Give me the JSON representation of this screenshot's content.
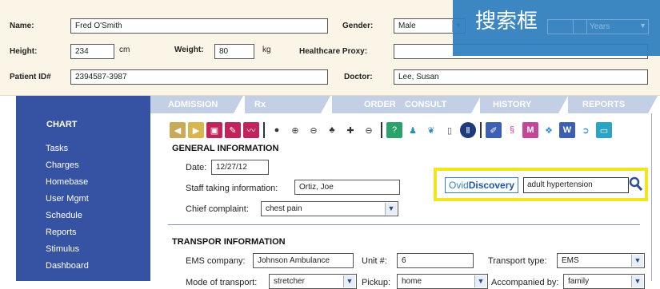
{
  "overlay": {
    "title": "搜索框",
    "ghost_value": "Years"
  },
  "form": {
    "name_label": "Name:",
    "name_value": "Fred O'Smith",
    "gender_label": "Gender:",
    "gender_value": "Male",
    "height_label": "Height:",
    "height_value": "234",
    "height_unit": "cm",
    "weight_label": "Weight:",
    "weight_value": "80",
    "weight_unit": "kg",
    "proxy_label": "Healthcare Proxy:",
    "proxy_value": "",
    "patient_id_label": "Patient ID#",
    "patient_id_value": "2394587-3987",
    "doctor_label": "Doctor:",
    "doctor_value": "Lee, Susan"
  },
  "tabs": [
    {
      "label": "ADMISSION"
    },
    {
      "label": "Rx"
    },
    {
      "label": "ORDERS"
    },
    {
      "label": "CONSULT"
    },
    {
      "label": "HISTORY"
    },
    {
      "label": "REPORTS"
    }
  ],
  "sidebar": {
    "heading": "CHART",
    "items": [
      "Tasks",
      "Charges",
      "Homebase",
      "User Mgmt",
      "Schedule",
      "Reports",
      "Stimulus",
      "Dashboard"
    ]
  },
  "toolbar_icons": [
    "arrow-left-icon",
    "arrow-right-icon",
    "device-icon",
    "note-icon",
    "chart-icon",
    "globe-icon",
    "zoom-icon",
    "zoom-out-icon",
    "people-icon",
    "pill-icon",
    "bed-icon",
    "help-icon",
    "person-icon",
    "lungs-icon",
    "battery-icon",
    "stop-icon",
    "pen-icon",
    "dna-icon",
    "m-icon",
    "book-icon",
    "w-icon",
    "plug-icon",
    "monitor-icon"
  ],
  "general": {
    "heading": "GENERAL INFORMATION",
    "date_label": "Date:",
    "date_value": "12/27/12",
    "staff_label": "Staff taking information:",
    "staff_value": "Ortiz, Joe",
    "complaint_label": "Chief complaint:",
    "complaint_value": "chest pain"
  },
  "search": {
    "logo_a": "Ovid",
    "logo_b": "Discovery",
    "query": "adult hypertension"
  },
  "transport": {
    "heading": "TRANSPOR INFORMATION",
    "ems_label": "EMS company:",
    "ems_value": "Johnson Ambulance",
    "unit_label": "Unit #:",
    "unit_value": "6",
    "type_label": "Transport type:",
    "type_value": "EMS",
    "mode_label": "Mode of transport:",
    "mode_value": "stretcher",
    "pickup_label": "Pickup:",
    "pickup_value": "home",
    "accomp_label": "Accompanied by:",
    "accomp_value": "family"
  }
}
